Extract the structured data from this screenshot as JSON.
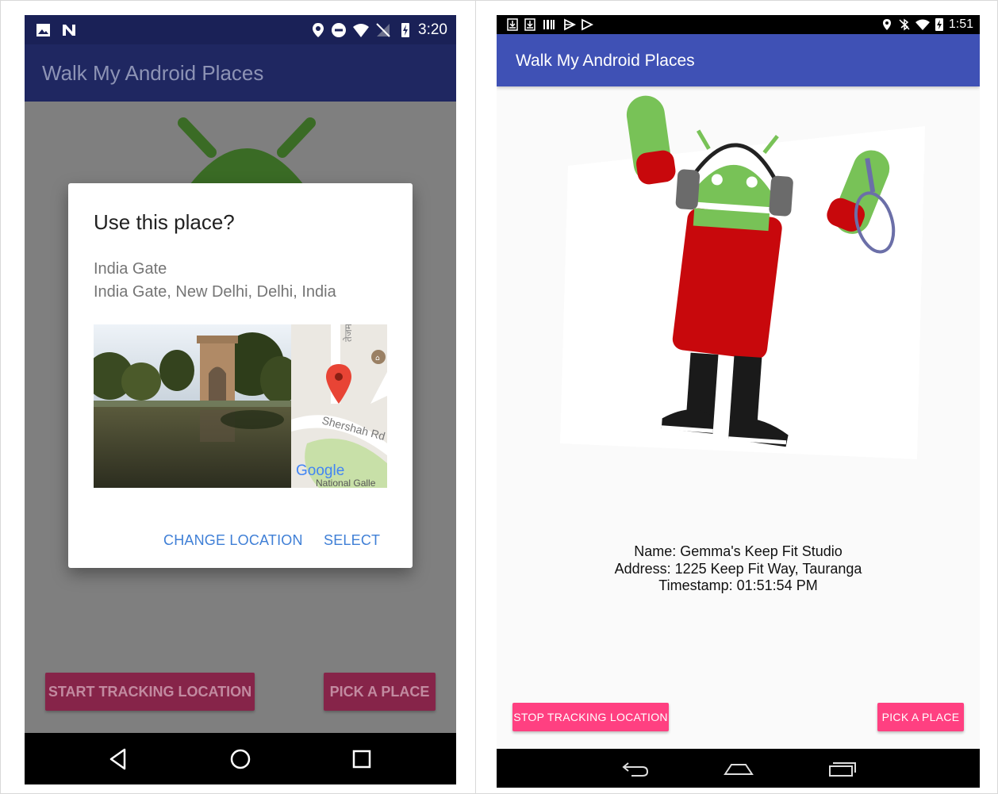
{
  "left_screen": {
    "status_bar": {
      "time": "3:20",
      "icons": [
        "image-icon",
        "n-icon",
        "location-icon",
        "do-not-disturb-icon",
        "wifi-icon",
        "no-sim-icon",
        "battery-charging-icon"
      ]
    },
    "app_bar": {
      "title": "Walk My Android Places"
    },
    "dialog": {
      "title": "Use this place?",
      "place_name": "India Gate",
      "place_address": "India Gate, New Delhi, Delhi, India",
      "map": {
        "street_label": "Shershah Rd",
        "poi_label": "National Galle",
        "vertical_label": "तेजमार्ग",
        "logo": "Google"
      },
      "change_location_label": "CHANGE LOCATION",
      "select_label": "SELECT"
    },
    "buttons": {
      "start_tracking": "START TRACKING LOCATION",
      "pick_place": "PICK A PLACE"
    },
    "nav_bar": [
      "back-icon",
      "home-icon",
      "recents-icon"
    ]
  },
  "right_screen": {
    "status_bar": {
      "time": "1:51",
      "icons": [
        "download-icon",
        "download-icon",
        "barcode-icon",
        "play-store-icon",
        "play-icon",
        "location-icon",
        "bluetooth-off-icon",
        "wifi-icon",
        "battery-charging-icon"
      ]
    },
    "app_bar": {
      "title": "Walk My Android Places"
    },
    "place_info": {
      "name": "Name: Gemma's Keep Fit Studio",
      "address": "Address: 1225 Keep Fit Way, Tauranga",
      "timestamp": "Timestamp: 01:51:54 PM"
    },
    "buttons": {
      "stop_tracking": "STOP TRACKING LOCATION",
      "pick_place": "PICK A PLACE"
    },
    "nav_bar": [
      "back-icon",
      "home-icon",
      "recents-icon"
    ]
  },
  "colors": {
    "left_app_bar": "#1f2761",
    "right_app_bar": "#3f51b5",
    "accent_pink": "#ff4081",
    "dialog_button": "#3f7fd6",
    "android_green": "#78c257",
    "shirt_red": "#c8080c"
  }
}
